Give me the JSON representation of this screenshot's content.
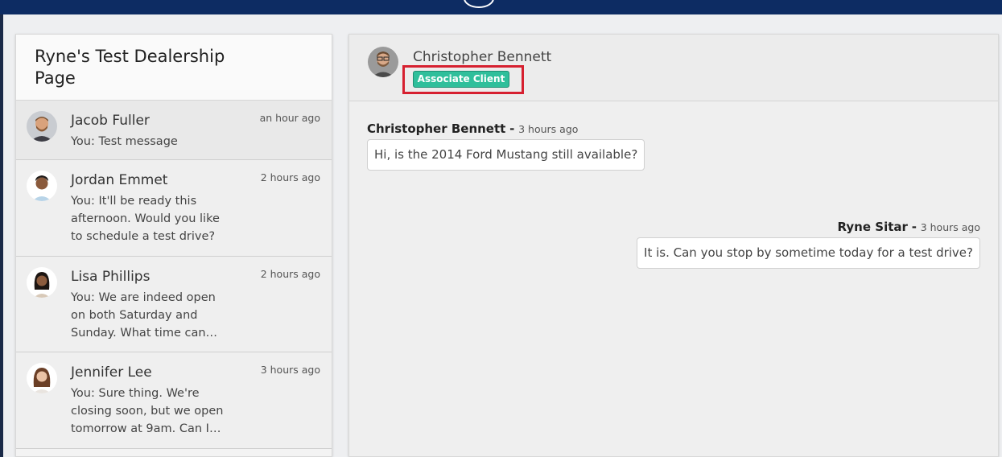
{
  "left_panel": {
    "title": "Ryne's Test Dealership Page",
    "conversations": [
      {
        "name": "Jacob Fuller",
        "time": "an hour ago",
        "preview": "You: Test message"
      },
      {
        "name": "Jordan Emmet",
        "time": "2 hours ago",
        "preview": "You: It'll be ready this afternoon. Would you like to schedule a test drive?"
      },
      {
        "name": "Lisa Phillips",
        "time": "2 hours ago",
        "preview": "You: We are indeed open on both Saturday and Sunday. What time can…"
      },
      {
        "name": "Jennifer Lee",
        "time": "3 hours ago",
        "preview": "You: Sure thing. We're closing soon, but we open tomorrow at 9am. Can I…"
      }
    ]
  },
  "chat": {
    "contact_name": "Christopher Bennett",
    "associate_label": "Associate Client",
    "messages": [
      {
        "sender": "Christopher Bennett",
        "separator": "-",
        "time": "3 hours ago",
        "text": "Hi, is the 2014 Ford Mustang still available?"
      },
      {
        "sender": "Ryne Sitar",
        "separator": "-",
        "time": "3 hours ago",
        "text": "It is. Can you stop by sometime today for a test drive?"
      }
    ]
  },
  "colors": {
    "topbar": "#0d2c63",
    "associate_button": "#2fbf9b",
    "highlight_border": "#d62030"
  }
}
